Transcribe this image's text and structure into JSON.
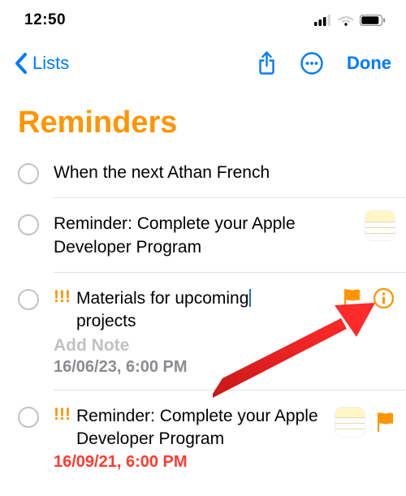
{
  "status": {
    "time": "12:50"
  },
  "nav": {
    "back_label": "Lists",
    "done_label": "Done"
  },
  "title": "Reminders",
  "reminders": [
    {
      "text": "When the next Athan French"
    },
    {
      "text": "Reminder: Complete your Apple Developer Program"
    },
    {
      "priority": "!!!",
      "text_a": "Materials for upcoming",
      "text_b": "projects",
      "add_note": "Add Note",
      "datetime": "16/06/23, 6:00 PM"
    },
    {
      "priority": "!!!",
      "text": "Reminder: Complete your Apple Developer Program",
      "datetime": "16/09/21, 6:00 PM",
      "overdue": true
    }
  ]
}
